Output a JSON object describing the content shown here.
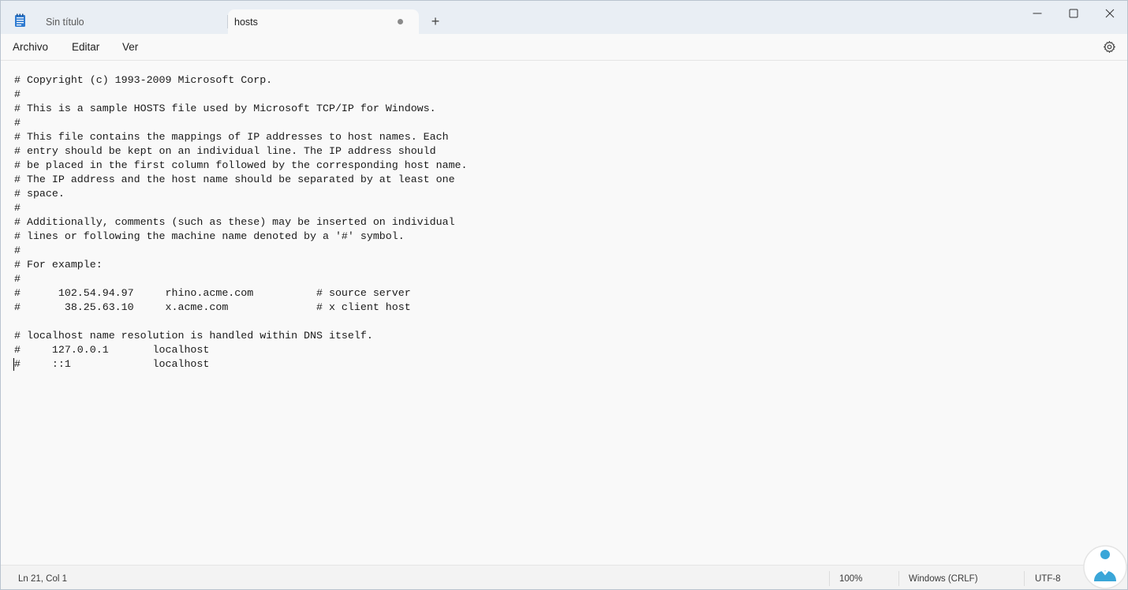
{
  "tabs": [
    {
      "label": "Sin título",
      "active": false
    },
    {
      "label": "hosts",
      "active": true,
      "modified": true
    }
  ],
  "menu": {
    "archivo": "Archivo",
    "editar": "Editar",
    "ver": "Ver"
  },
  "editor": {
    "lines": [
      "# Copyright (c) 1993-2009 Microsoft Corp.",
      "#",
      "# This is a sample HOSTS file used by Microsoft TCP/IP for Windows.",
      "#",
      "# This file contains the mappings of IP addresses to host names. Each",
      "# entry should be kept on an individual line. The IP address should",
      "# be placed in the first column followed by the corresponding host name.",
      "# The IP address and the host name should be separated by at least one",
      "# space.",
      "#",
      "# Additionally, comments (such as these) may be inserted on individual",
      "# lines or following the machine name denoted by a '#' symbol.",
      "#",
      "# For example:",
      "#",
      "#      102.54.94.97     rhino.acme.com          # source server",
      "#       38.25.63.10     x.acme.com              # x client host",
      "",
      "# localhost name resolution is handled within DNS itself.",
      "#     127.0.0.1       localhost",
      "#     ::1             localhost"
    ]
  },
  "status": {
    "position": "Ln 21, Col 1",
    "zoom": "100%",
    "line_ending": "Windows (CRLF)",
    "encoding": "UTF-8"
  },
  "icons": {
    "app": "notepad-icon",
    "new_tab": "plus-icon",
    "settings": "gear-icon",
    "minimize": "minimize-icon",
    "maximize": "maximize-icon",
    "close": "close-icon"
  },
  "colors": {
    "titlebar": "#e9eef4",
    "background": "#f9f9f9",
    "accent": "#1a73c8"
  }
}
